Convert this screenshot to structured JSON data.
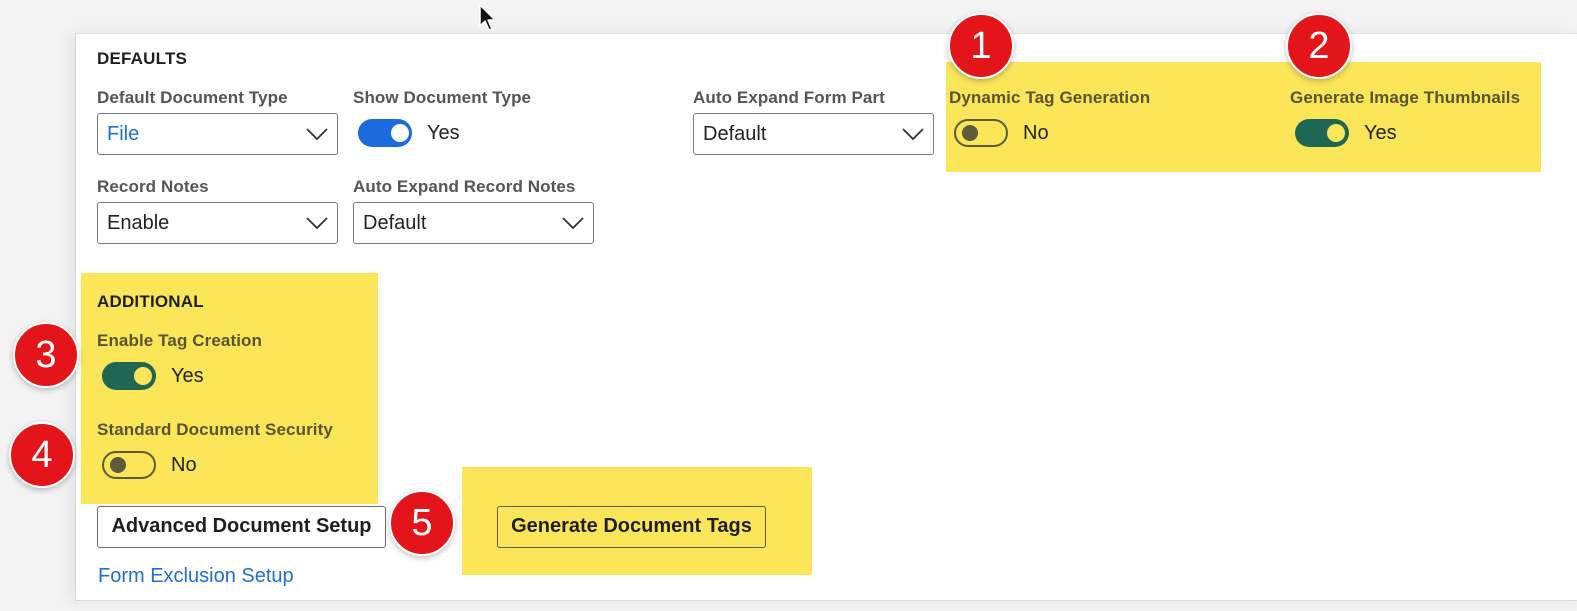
{
  "colors": {
    "highlight": "#fbe65a",
    "badge": "#e3151a",
    "toggle_blue": "#1a6bdb",
    "toggle_green": "#1f6654",
    "link": "#1f6fd1"
  },
  "defaults": {
    "title": "DEFAULTS",
    "default_document_type": {
      "label": "Default Document Type",
      "value": "File"
    },
    "show_document_type": {
      "label": "Show Document Type",
      "state": "on",
      "value": "Yes"
    },
    "auto_expand_form_part": {
      "label": "Auto Expand Form Part",
      "value": "Default"
    },
    "dynamic_tag_generation": {
      "label": "Dynamic Tag Generation",
      "state": "off",
      "value": "No"
    },
    "generate_image_thumbnails": {
      "label": "Generate Image Thumbnails",
      "state": "on",
      "value": "Yes"
    },
    "record_notes": {
      "label": "Record Notes",
      "value": "Enable"
    },
    "auto_expand_record_notes": {
      "label": "Auto Expand Record Notes",
      "value": "Default"
    }
  },
  "additional": {
    "title": "ADDITIONAL",
    "enable_tag_creation": {
      "label": "Enable Tag Creation",
      "state": "on",
      "value": "Yes"
    },
    "standard_document_security": {
      "label": "Standard Document Security",
      "state": "off",
      "value": "No"
    }
  },
  "buttons": {
    "advanced_document_setup": "Advanced Document Setup",
    "generate_document_tags": "Generate Document Tags"
  },
  "links": {
    "form_exclusion_setup": "Form Exclusion Setup"
  },
  "badges": [
    "1",
    "2",
    "3",
    "4",
    "5"
  ],
  "icons": {
    "chevron": "chevron-down-icon",
    "cursor": "mouse-pointer-icon"
  }
}
